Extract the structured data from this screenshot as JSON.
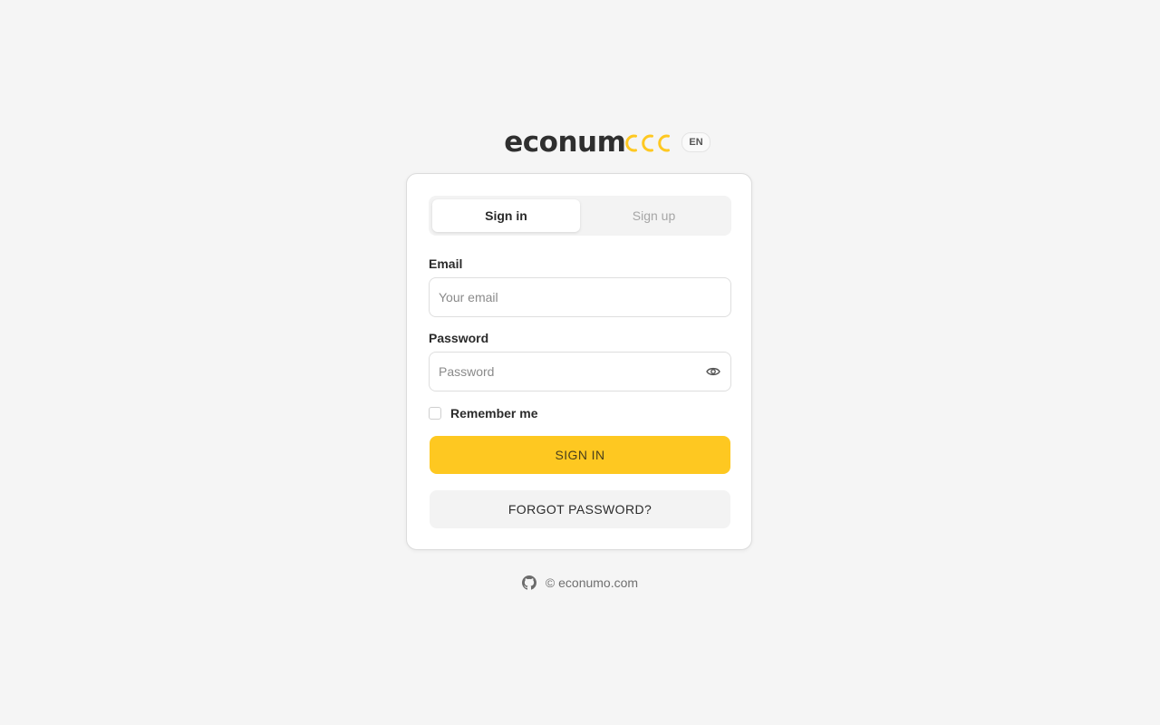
{
  "header": {
    "logo_text": "econum",
    "logo_icon": "econumo-coins-logo-mark",
    "language": "EN"
  },
  "auth": {
    "tabs": [
      {
        "label": "Sign in",
        "active": true
      },
      {
        "label": "Sign up",
        "active": false
      }
    ],
    "email": {
      "label": "Email",
      "placeholder": "Your email",
      "value": ""
    },
    "password": {
      "label": "Password",
      "placeholder": "Password",
      "value": "",
      "toggle_icon": "eye-icon"
    },
    "remember_me": {
      "label": "Remember me",
      "checked": false
    },
    "sign_in_button": "SIGN IN",
    "forgot_password_button": "FORGOT PASSWORD?"
  },
  "footer": {
    "icon": "github-icon",
    "copyright": "© econumo.com"
  },
  "colors": {
    "background": "#f5f5f5",
    "accent": "#fec821",
    "text": "#2b2b2b",
    "muted": "#a6a6a6"
  }
}
